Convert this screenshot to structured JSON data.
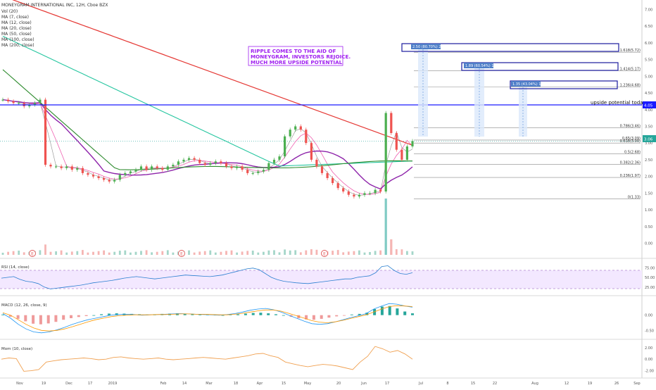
{
  "header": {
    "title": "MONEYGRAM INTERNATIONAL INC, 12H, Cboe BZX",
    "indicators": [
      "Vol (20)",
      "MA (7, close)",
      "MA (12, close)",
      "MA (20, close)",
      "MA (50, close)",
      "MA (100, close)",
      "MA (200, close)"
    ]
  },
  "annotations": {
    "ripple_lines": [
      "RIPPLE COMES TO THE AID OF",
      "MONEYGRAM, INVESTORS REJOICE.",
      "MUCH MORE UPSIDE POTENTIAL"
    ],
    "upside_label": "upside potential today",
    "targets": [
      {
        "label": "2.50 (80.70%) 250",
        "fib": "1.618(5.72)",
        "price": 5.72
      },
      {
        "label": "1.89 (60.54%) 189",
        "fib": "1.414(5.17)",
        "price": 5.17
      },
      {
        "label": "1.35 (43.04%) 135",
        "fib": "1.236(4.68)",
        "price": 4.68
      }
    ],
    "event_markers": [
      "E",
      "E",
      "E"
    ]
  },
  "price_badges": {
    "line": "4.05",
    "current": "3.06"
  },
  "colors": {
    "up": "#26a69a",
    "up_candle": "#4caf50",
    "down": "#ef5350",
    "ma_red": "#e53935",
    "ma_teal": "#26c6a0",
    "ma_green": "#2e8b2e",
    "ma_purple": "#8e24aa",
    "ma_pink": "#ef5fb0",
    "blue_line": "#1a1aff",
    "annotation_purple": "#a020f0"
  },
  "chart_data": [
    {
      "type": "line",
      "title": "MONEYGRAM INTERNATIONAL INC, 12H, Cboe BZX",
      "x_ticks": [
        "Nov",
        "19",
        "Dec",
        "17",
        "2019",
        "Feb",
        "14",
        "Mar",
        "18",
        "Apr",
        "15",
        "May",
        "20",
        "Jun",
        "17",
        "Jul",
        "8",
        "15",
        "22",
        "Aug",
        "12",
        "19",
        "26",
        "Sep"
      ],
      "y_ticks": [
        "7.00",
        "6.50",
        "6.00",
        "5.50",
        "5.00",
        "4.50",
        "4.00",
        "3.50",
        "3.00",
        "2.50",
        "2.00",
        "1.50",
        "1.00",
        "0.50",
        "0.00"
      ],
      "ylim": [
        -0.2,
        7.2
      ],
      "price_line": 4.05,
      "current_price": 3.06,
      "fib_levels": [
        {
          "label": "1.618(5.72)",
          "value": 5.72
        },
        {
          "label": "1.414(5.17)",
          "value": 5.17
        },
        {
          "label": "1.236(4.68)",
          "value": 4.68
        },
        {
          "label": "0.786(3.46)",
          "value": 3.46
        },
        {
          "label": "0.65(3.09)",
          "value": 3.09
        },
        {
          "label": "0.618(3.00)",
          "value": 3.0
        },
        {
          "label": "0.5(2.68)",
          "value": 2.68
        },
        {
          "label": "0.382(2.36)",
          "value": 2.36
        },
        {
          "label": "0.236(1.97)",
          "value": 1.97
        },
        {
          "label": "0(1.33)",
          "value": 1.33
        }
      ],
      "price_series": [
        4.3,
        4.25,
        4.2,
        4.2,
        4.1,
        4.15,
        4.2,
        4.3,
        2.35,
        2.3,
        2.3,
        2.25,
        2.3,
        2.2,
        2.25,
        2.1,
        2.05,
        2.0,
        1.95,
        1.9,
        1.85,
        1.9,
        2.05,
        2.1,
        2.15,
        2.2,
        2.3,
        2.2,
        2.3,
        2.25,
        2.2,
        2.3,
        2.35,
        2.45,
        2.5,
        2.55,
        2.5,
        2.4,
        2.35,
        2.4,
        2.45,
        2.4,
        2.3,
        2.25,
        2.3,
        2.2,
        2.1,
        2.1,
        2.15,
        2.2,
        2.4,
        2.5,
        2.6,
        3.2,
        3.4,
        3.5,
        3.4,
        3.0,
        2.5,
        2.3,
        2.1,
        1.95,
        1.8,
        1.65,
        1.55,
        1.45,
        1.4,
        1.45,
        1.5,
        1.5,
        1.6,
        1.55,
        3.9,
        3.3,
        2.8,
        2.5,
        2.9,
        3.06
      ]
    },
    {
      "type": "line",
      "title": "RSI (14, close)",
      "y_ticks": [
        "75.00",
        "50.00",
        "25.00"
      ],
      "ylim": [
        10,
        90
      ],
      "bands": [
        30,
        70
      ],
      "values": [
        48,
        50,
        52,
        45,
        40,
        38,
        34,
        25,
        20,
        22,
        24,
        26,
        28,
        30,
        33,
        36,
        38,
        40,
        42,
        45,
        48,
        50,
        52,
        50,
        48,
        46,
        48,
        50,
        52,
        54,
        56,
        55,
        54,
        53,
        52,
        54,
        56,
        60,
        64,
        68,
        72,
        74,
        70,
        60,
        50,
        44,
        40,
        38,
        36,
        35,
        34,
        36,
        38,
        40,
        42,
        44,
        46,
        46,
        50,
        52,
        54,
        62,
        78,
        80,
        68,
        60,
        58,
        62
      ]
    },
    {
      "type": "bar",
      "title": "MACD (12, 26, close, 9)",
      "y_ticks": [
        "0.00",
        "-0.50"
      ],
      "ylim": [
        -0.7,
        0.5
      ],
      "histogram": [
        0.02,
        -0.05,
        -0.12,
        -0.2,
        -0.28,
        -0.3,
        -0.27,
        -0.22,
        -0.15,
        -0.1,
        -0.06,
        -0.03,
        0.0,
        0.03,
        0.05,
        0.06,
        0.05,
        0.04,
        0.03,
        0.02,
        0.03,
        0.04,
        0.05,
        0.06,
        0.05,
        0.04,
        0.03,
        0.02,
        0.01,
        0.0,
        0.02,
        0.03,
        0.05,
        0.07,
        0.08,
        0.06,
        0.03,
        0.0,
        -0.05,
        -0.1,
        -0.14,
        -0.15,
        -0.12,
        -0.08,
        -0.04,
        -0.01,
        0.02,
        0.04,
        0.08,
        0.2,
        0.28,
        0.3,
        0.22,
        0.12,
        0.06
      ],
      "macd": [
        0.05,
        -0.1,
        -0.3,
        -0.45,
        -0.55,
        -0.58,
        -0.55,
        -0.48,
        -0.4,
        -0.3,
        -0.22,
        -0.15,
        -0.1,
        -0.05,
        0.0,
        0.02,
        0.03,
        0.02,
        0.0,
        0.01,
        0.02,
        0.03,
        0.04,
        0.05,
        0.04,
        0.03,
        0.02,
        0.01,
        0.0,
        0.02,
        0.05,
        0.1,
        0.16,
        0.2,
        0.22,
        0.18,
        0.1,
        0.0,
        -0.1,
        -0.2,
        -0.28,
        -0.3,
        -0.28,
        -0.22,
        -0.15,
        -0.08,
        -0.02,
        0.05,
        0.2,
        0.3,
        0.38,
        0.36,
        0.3,
        0.26
      ],
      "signal": [
        0.08,
        0.0,
        -0.15,
        -0.3,
        -0.42,
        -0.5,
        -0.52,
        -0.5,
        -0.45,
        -0.38,
        -0.3,
        -0.22,
        -0.15,
        -0.1,
        -0.05,
        -0.02,
        0.0,
        0.01,
        0.01,
        0.01,
        0.02,
        0.02,
        0.03,
        0.04,
        0.04,
        0.03,
        0.03,
        0.02,
        0.01,
        0.01,
        0.03,
        0.06,
        0.1,
        0.14,
        0.17,
        0.17,
        0.13,
        0.06,
        -0.02,
        -0.1,
        -0.18,
        -0.23,
        -0.25,
        -0.22,
        -0.17,
        -0.11,
        -0.05,
        0.01,
        0.1,
        0.2,
        0.28,
        0.31,
        0.3,
        0.28
      ]
    },
    {
      "type": "line",
      "title": "Mom (10, close)",
      "y_ticks": [
        "2.00",
        "0.00",
        "-2.00"
      ],
      "ylim": [
        -2.9,
        2.7
      ],
      "values": [
        0.0,
        0.2,
        0.1,
        -2.1,
        -2.0,
        -1.8,
        -0.5,
        -0.3,
        -0.1,
        0.0,
        0.1,
        0.2,
        0.1,
        -0.1,
        0.0,
        0.3,
        0.4,
        0.2,
        0.1,
        0.0,
        0.1,
        0.2,
        0.0,
        -0.1,
        0.0,
        0.1,
        0.2,
        0.3,
        0.2,
        0.1,
        0.0,
        0.2,
        0.4,
        0.6,
        0.9,
        1.0,
        0.6,
        0.3,
        -0.5,
        -0.8,
        -1.1,
        -1.3,
        -1.1,
        -0.9,
        -1.0,
        -1.2,
        -1.5,
        -1.8,
        -0.5,
        0.5,
        2.2,
        1.8,
        1.2,
        1.5,
        0.9,
        0.0
      ]
    }
  ]
}
